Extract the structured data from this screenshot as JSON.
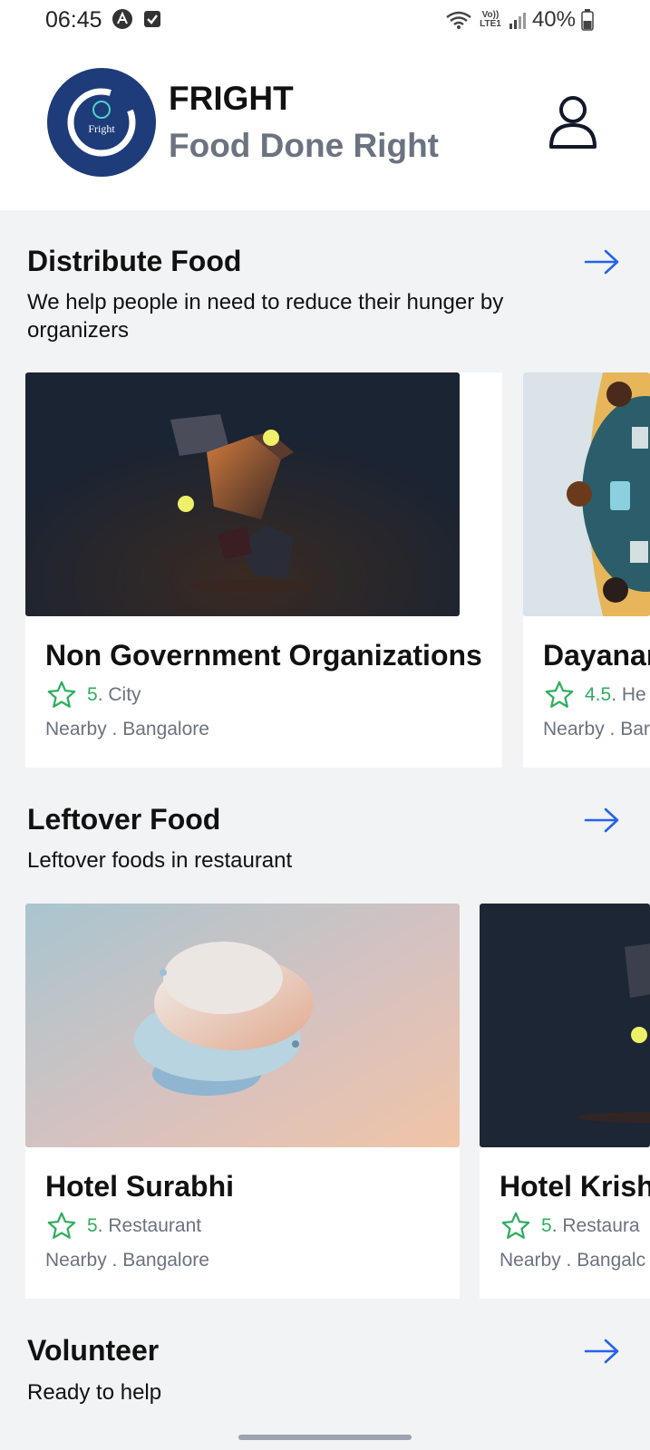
{
  "status_bar": {
    "time": "06:45",
    "network": "Vo)) LTE1",
    "battery": "40%"
  },
  "header": {
    "logo_text": "Fright",
    "title": "FRIGHT",
    "subtitle": "Food Done Right"
  },
  "sections": [
    {
      "title": "Distribute Food",
      "description": "We help people in need to reduce their hunger by organizers",
      "cards": [
        {
          "name": "Non Government Organizations",
          "rating": "5",
          "category": ". City",
          "location": "Nearby . Bangalore"
        },
        {
          "name": "Dayanar",
          "rating": "4.5",
          "category": ". He",
          "location": "Nearby . Bar"
        }
      ]
    },
    {
      "title": "Leftover Food",
      "description": "Leftover foods in restaurant",
      "cards": [
        {
          "name": "Hotel Surabhi",
          "rating": "5",
          "category": ". Restaurant",
          "location": "Nearby . Bangalore"
        },
        {
          "name": "Hotel Krish",
          "rating": "5",
          "category": ". Restaura",
          "location": "Nearby . Bangalc"
        }
      ]
    },
    {
      "title": "Volunteer",
      "description": "Ready to help"
    }
  ],
  "colors": {
    "accent": "#2563eb",
    "rating_green": "#2fae5f",
    "logo_bg": "#1e3b7a"
  }
}
